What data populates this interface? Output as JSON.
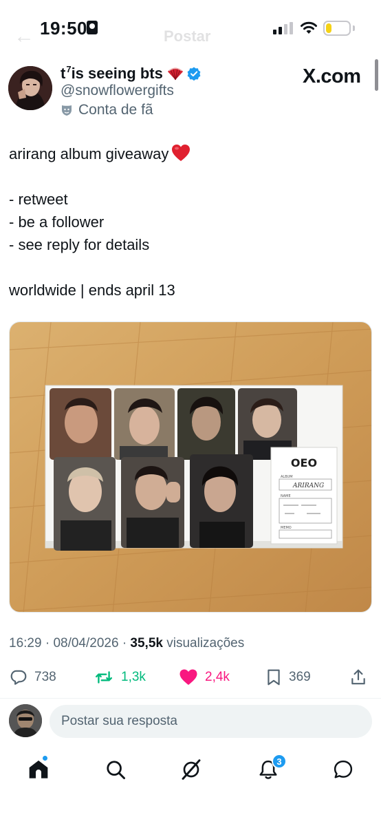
{
  "status_bar": {
    "time": "19:50",
    "battery_level": 0.25,
    "battery_color": "#f5d216"
  },
  "header_ghost": {
    "title": "Postar"
  },
  "author": {
    "display_name": "t",
    "display_name_sup": "7",
    "display_name_rest": " is seeing bts",
    "handle": "@snowflowergifts",
    "label": "Conta de fã",
    "watermark": "X.com"
  },
  "tweet": {
    "lines": [
      "arirang album giveaway",
      "",
      "- retweet",
      "- be a follower",
      "- see reply for details",
      "",
      "worldwide | ends april 13"
    ]
  },
  "media": {
    "card_logo": "OEO",
    "card_album_label": "ALBUM",
    "card_album_value": "ARIRANG",
    "card_name_label": "NAME",
    "card_memo_label": "MEMO"
  },
  "meta": {
    "time": "16:29",
    "date": "08/04/2026",
    "views": "35,5k",
    "views_label": "visualizações",
    "sep": "·"
  },
  "actions": {
    "replies": "738",
    "reposts": "1,3k",
    "likes": "2,4k",
    "bookmarks": "369"
  },
  "composer": {
    "placeholder": "Postar sua resposta"
  },
  "nav": {
    "notifications_badge": "3"
  },
  "colors": {
    "accent": "#1d9bf0",
    "repost": "#00ba7c",
    "like": "#f91880",
    "secondary_text": "#536471"
  },
  "icons": [
    "back-arrow-icon",
    "focus-icon",
    "signal-icon",
    "wifi-icon",
    "battery-icon",
    "fan-icon",
    "verified-icon",
    "fan-account-icon",
    "reply-icon",
    "repost-icon",
    "like-icon",
    "bookmark-icon",
    "share-icon",
    "home-icon",
    "search-icon",
    "grok-icon",
    "notifications-icon",
    "messages-icon"
  ]
}
